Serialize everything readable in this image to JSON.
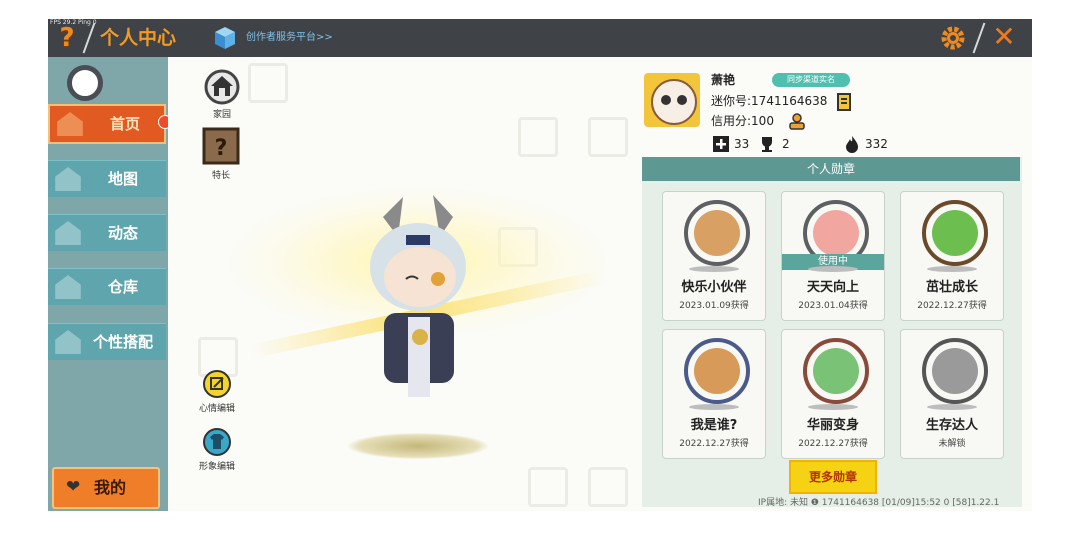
{
  "topbar": {
    "fps": "FPS 29.2  Ping 0",
    "help_glyph": "?",
    "title": "个人中心",
    "platform_link": "创作者服务平台>>",
    "close_glyph": "✕"
  },
  "sidebar": {
    "items": [
      {
        "label": "首页",
        "icon": "home-icon"
      },
      {
        "label": "地图",
        "icon": "map-icon"
      },
      {
        "label": "动态",
        "icon": "bell-icon"
      },
      {
        "label": "仓库",
        "icon": "warehouse-icon"
      },
      {
        "label": "个性搭配",
        "icon": "outfit-icon"
      }
    ],
    "me_label": "我的"
  },
  "side_actions": {
    "home": "家园",
    "talent": "特长",
    "mood_edit": "心情编辑",
    "look_edit": "形象编辑"
  },
  "profile": {
    "name": "萧艳",
    "sync_tag": "同步渠道实名",
    "mini_id": "迷你号:1741164638",
    "credit": "信用分:100",
    "stats": {
      "plus": "33",
      "trophy": "2",
      "fire": "332"
    }
  },
  "medals": {
    "header": "个人勋章",
    "cards": [
      {
        "name": "快乐小伙伴",
        "date": "2023.01.09获得",
        "in_use": ""
      },
      {
        "name": "天天向上",
        "date": "2023.01.04获得",
        "in_use": "使用中"
      },
      {
        "name": "茁壮成长",
        "date": "2022.12.27获得",
        "in_use": ""
      },
      {
        "name": "我是谁?",
        "date": "2022.12.27获得",
        "in_use": ""
      },
      {
        "name": "华丽变身",
        "date": "2022.12.27获得",
        "in_use": ""
      },
      {
        "name": "生存达人",
        "date": "未解锁",
        "in_use": ""
      }
    ],
    "more_label": "更多勋章"
  },
  "footer": {
    "info": "IP属地: 未知 ❶    1741164638   [01/09]15:52 0  [58]1.22.1"
  },
  "colors": {
    "topbar": "#3f4348",
    "accent_orange": "#f08a1c",
    "nav_teal": "#5fa5ad",
    "nav_active": "#e05a22",
    "panel_header": "#5e9893",
    "more_button": "#f5d312"
  }
}
